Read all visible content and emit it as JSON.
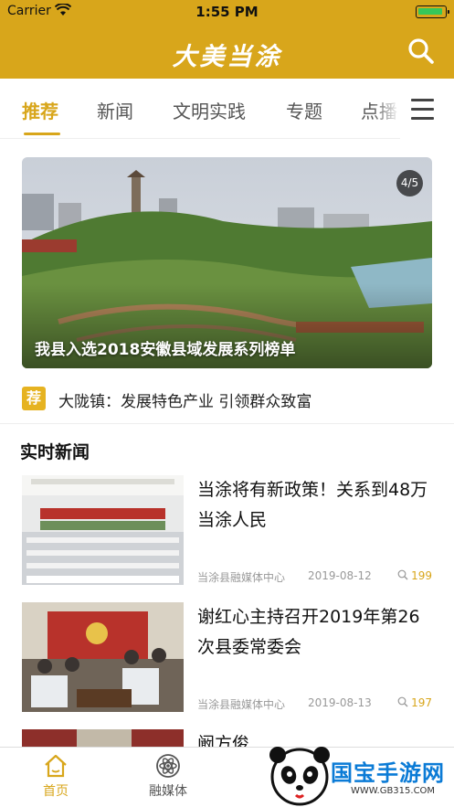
{
  "status_bar": {
    "carrier": "Carrier",
    "time": "1:55 PM"
  },
  "header": {
    "title": "大美当涂"
  },
  "tabs": [
    {
      "label": "推荐",
      "active": true
    },
    {
      "label": "新闻",
      "active": false
    },
    {
      "label": "文明实践",
      "active": false
    },
    {
      "label": "专题",
      "active": false
    },
    {
      "label": "点播",
      "active": false
    }
  ],
  "banner": {
    "counter": "4/5",
    "caption": "我县入选2018安徽县域发展系列榜单"
  },
  "recommend": {
    "badge": "荐",
    "text": "大陇镇：发展特色产业 引领群众致富"
  },
  "section": {
    "title": "实时新闻"
  },
  "news": [
    {
      "headline": "当涂将有新政策！关系到48万当涂人民",
      "source": "当涂县融媒体中心",
      "date": "2019-08-12",
      "views": "199"
    },
    {
      "headline": "谢红心主持召开2019年第26次县委常委会",
      "source": "当涂县融媒体中心",
      "date": "2019-08-13",
      "views": "197"
    },
    {
      "headline": "阚方俊"
    }
  ],
  "bottom_nav": [
    {
      "label": "首页",
      "icon": "home-icon",
      "active": true
    },
    {
      "label": "融媒体",
      "icon": "atom-icon",
      "active": false
    }
  ],
  "watermark": {
    "text": "国宝手游网",
    "sub": "WWW.GB315.COM"
  },
  "colors": {
    "accent": "#d8a61b",
    "badge": "#e6b321",
    "battery": "#35c759",
    "watermark": "#0b7bd6"
  }
}
